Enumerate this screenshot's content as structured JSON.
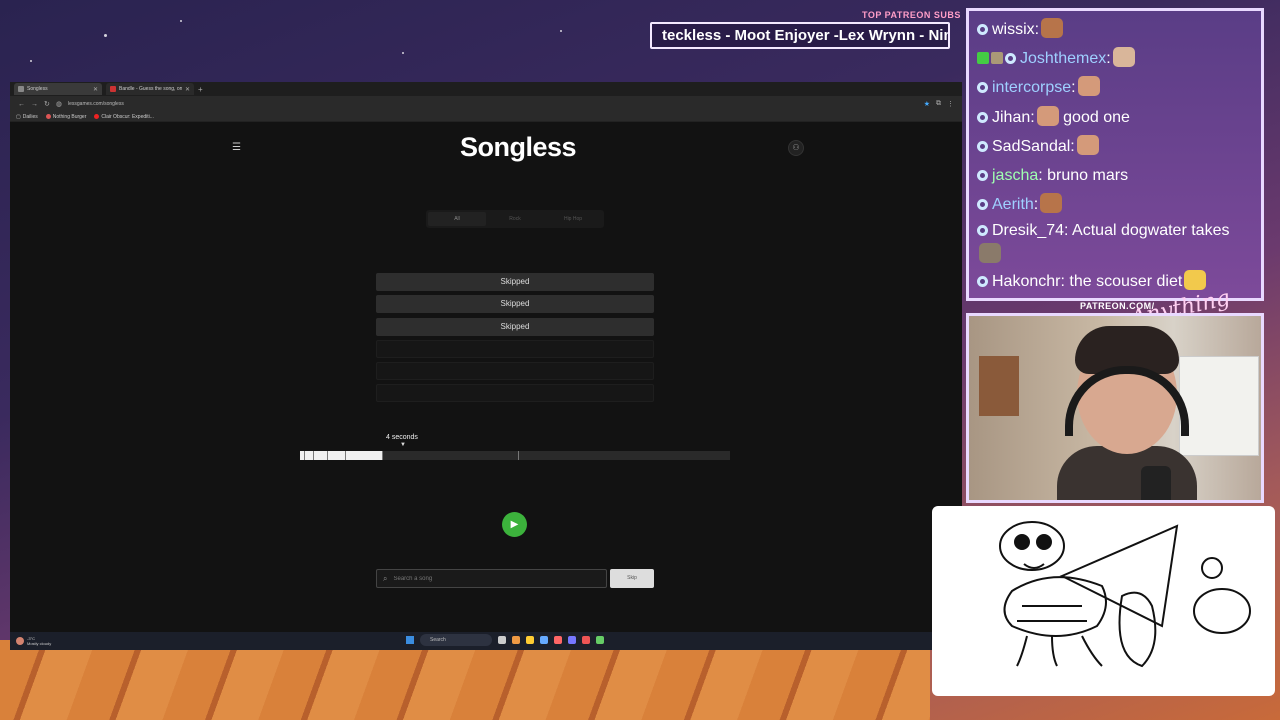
{
  "overlay": {
    "patreon_label": "TOP PATREON SUBS",
    "ticker_text": "teckless - Moot Enjoyer -Lex Wrynn - Nim",
    "patreon_link": "PATREON.COM/"
  },
  "browser": {
    "tabs": [
      {
        "label": "Songless",
        "active": true
      },
      {
        "label": "Bandle - Guess the song, one in"
      }
    ],
    "url": "lessgames.com/songless",
    "bookmarks": [
      "Dailies",
      "Nothing Burger",
      "Clair Obscur: Expediti..."
    ]
  },
  "page": {
    "logo": "Songless",
    "genres": [
      {
        "label": "All",
        "active": true
      },
      {
        "label": "Rock",
        "active": false
      },
      {
        "label": "Hip Hop",
        "active": false
      }
    ],
    "guesses": [
      {
        "label": "Skipped"
      },
      {
        "label": "Skipped"
      },
      {
        "label": "Skipped"
      },
      {
        "label": ""
      },
      {
        "label": ""
      },
      {
        "label": ""
      }
    ],
    "duration_label": "4 seconds",
    "progress_fraction": 0.19,
    "search_placeholder": "Search a song",
    "skip_label": "Skip"
  },
  "taskbar": {
    "weather_temp": "-3°C",
    "weather_desc": "Mostly cloudy",
    "search_label": "Search"
  },
  "chat": {
    "messages": [
      {
        "user": "wissix",
        "text": "",
        "user_color": "#ffffff"
      },
      {
        "user": "Joshthemex",
        "text": "",
        "user_color": "#9fd0ff"
      },
      {
        "user": "intercorpse",
        "text": "",
        "user_color": "#9fd0ff"
      },
      {
        "user": "Jihan",
        "text": "good one",
        "user_color": "#ffffff"
      },
      {
        "user": "SadSandal",
        "text": "",
        "user_color": "#ffffff"
      },
      {
        "user": "jascha",
        "text": "bruno mars",
        "user_color": "#9fffb0"
      },
      {
        "user": "Aerith",
        "text": "",
        "user_color": "#9fd0ff"
      },
      {
        "user": "Dresik_74",
        "text": "Actual dogwater takes",
        "user_color": "#ffffff"
      },
      {
        "user": "Hakonchr",
        "text": "the scouser diet",
        "user_color": "#ffffff"
      }
    ]
  }
}
